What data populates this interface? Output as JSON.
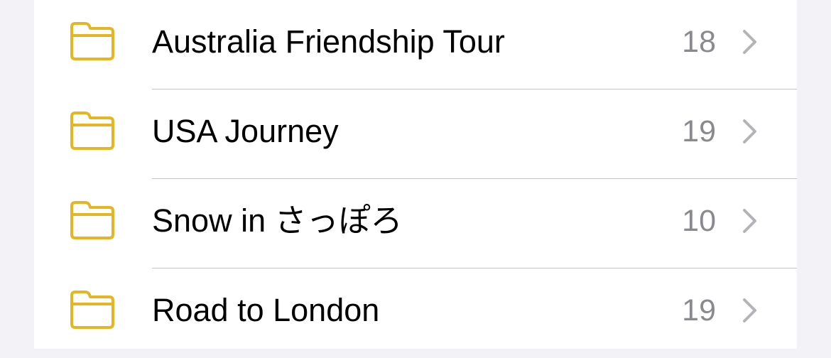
{
  "colors": {
    "accent": "#E5B622",
    "background": "#F2F2F7",
    "card": "#FFFFFF",
    "text": "#000000",
    "secondary_text": "#8A8A8E",
    "divider": "#C6C6C8",
    "chevron": "#B4B4B8"
  },
  "folders": [
    {
      "icon": "folder-icon",
      "name": "Australia Friendship Tour",
      "count": "18",
      "chevron_icon": "chevron-right-icon"
    },
    {
      "icon": "folder-icon",
      "name": "USA Journey",
      "count": "19",
      "chevron_icon": "chevron-right-icon"
    },
    {
      "icon": "folder-icon",
      "name": "Snow in さっぽろ",
      "count": "10",
      "chevron_icon": "chevron-right-icon"
    },
    {
      "icon": "folder-icon",
      "name": "Road to London",
      "count": "19",
      "chevron_icon": "chevron-right-icon"
    }
  ]
}
